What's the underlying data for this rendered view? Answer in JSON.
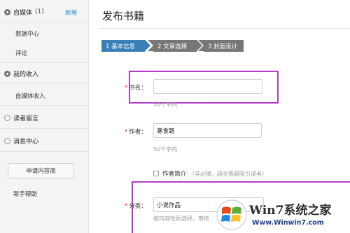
{
  "sidebar": {
    "media_section": {
      "label": "自媒体",
      "count": "(1)",
      "new_link": "新增"
    },
    "media_items": [
      "数据中心",
      "评论"
    ],
    "income_section": {
      "label": "我的收入"
    },
    "income_items": [
      "自媒体收入"
    ],
    "messages_section": {
      "label": "读者留言"
    },
    "notify_section": {
      "label": "消息中心"
    },
    "apply_button": "申请内容商",
    "help_link": "新手帮助"
  },
  "main": {
    "title": "发布书籍",
    "steps": [
      {
        "label": "1 基本信息",
        "state": "active"
      },
      {
        "label": "2 文章选择",
        "state": "inactive"
      },
      {
        "label": "3 封面设计",
        "state": "inactive"
      }
    ],
    "form": {
      "book_name": {
        "label": "书名：",
        "value": "",
        "hint": "50个字内"
      },
      "author": {
        "label": "作者：",
        "value": "寒食路",
        "hint": "50个字内"
      },
      "author_intro": {
        "label": "作者简介",
        "note": "（非必填，越全面越吸引读者）"
      },
      "category": {
        "label": "分类：",
        "value": "小说作品",
        "hint": "按内容性质选择，审核"
      }
    }
  },
  "watermark": {
    "text": "Win7系统之家",
    "url": "Www.Winwin7.com"
  },
  "colors": {
    "accent": "#3a7fb8",
    "required": "#d9252c",
    "highlight": "#b23cc8",
    "link": "#2a8bd6"
  }
}
